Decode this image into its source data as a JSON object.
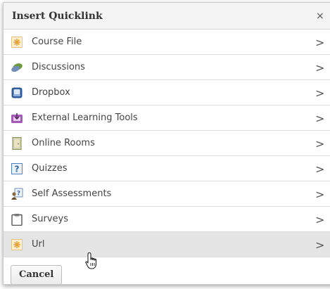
{
  "dialog": {
    "title": "Insert Quicklink",
    "close_glyph": "×",
    "items": [
      {
        "label": "Course File",
        "icon": "course-file-icon"
      },
      {
        "label": "Discussions",
        "icon": "discussions-icon"
      },
      {
        "label": "Dropbox",
        "icon": "dropbox-icon"
      },
      {
        "label": "External Learning Tools",
        "icon": "external-tools-icon"
      },
      {
        "label": "Online Rooms",
        "icon": "online-rooms-icon"
      },
      {
        "label": "Quizzes",
        "icon": "quizzes-icon"
      },
      {
        "label": "Self Assessments",
        "icon": "self-assessments-icon"
      },
      {
        "label": "Surveys",
        "icon": "surveys-icon"
      },
      {
        "label": "Url",
        "icon": "url-icon"
      }
    ],
    "chevron_glyph": ">",
    "cancel_label": "Cancel",
    "hovered_item": "Url"
  },
  "colors": {
    "header_bg": "#f4f4f4",
    "hover_bg": "#e5e5e5",
    "border": "#dcdcdc"
  }
}
